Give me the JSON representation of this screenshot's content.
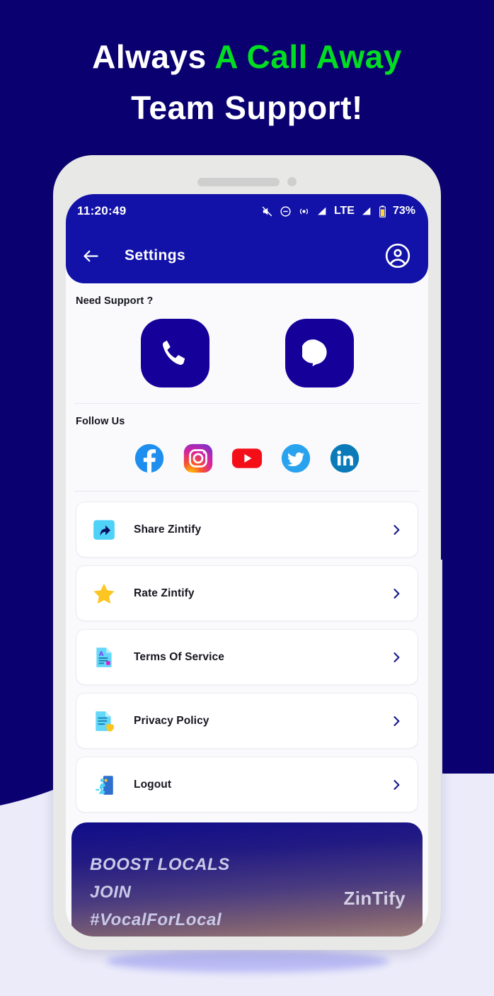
{
  "promo": {
    "headline_line1_white": "Always ",
    "headline_line1_green": "A Call Away",
    "headline_line2": "Team Support!",
    "green_accent": "#00dd22",
    "background_navy": "#0b0070",
    "background_lavender": "#ebebfa"
  },
  "phone": {
    "frame_color": "#e8e8e6",
    "screen_bg": "#fafafd"
  },
  "status_bar": {
    "time": "11:20:49",
    "icons": [
      "mute-icon",
      "do-not-disturb-icon",
      "hotspot-icon",
      "signal-icon"
    ],
    "network": "LTE",
    "second_signal": "signal-icon",
    "battery_icon": "battery-icon",
    "battery": "73%",
    "bar_color": "#1212a8"
  },
  "app_bar": {
    "back_icon": "arrow-left-icon",
    "title": "Settings",
    "account_icon": "account-circle-icon"
  },
  "support": {
    "label": "Need Support ?",
    "buttons": [
      {
        "name": "call-support-button",
        "icon": "phone-icon"
      },
      {
        "name": "chat-support-button",
        "icon": "chat-bubble-icon"
      }
    ],
    "button_color": "#150099"
  },
  "follow": {
    "label": "Follow Us",
    "networks": [
      {
        "name": "facebook",
        "icon": "facebook-icon",
        "color": "#1f8fef"
      },
      {
        "name": "instagram",
        "icon": "instagram-icon",
        "color": "#d6249f"
      },
      {
        "name": "youtube",
        "icon": "youtube-icon",
        "color": "#f40f18"
      },
      {
        "name": "twitter",
        "icon": "twitter-icon",
        "color": "#2aa3ef"
      },
      {
        "name": "linkedin",
        "icon": "linkedin-icon",
        "color": "#0a7bb8"
      }
    ]
  },
  "menu": {
    "chevron_icon": "chevron-right-icon",
    "chevron_color": "#1a1a8c",
    "items": [
      {
        "label": "Share Zintify",
        "icon": "share-icon"
      },
      {
        "label": "Rate Zintify",
        "icon": "star-icon"
      },
      {
        "label": "Terms Of Service",
        "icon": "document-text-icon"
      },
      {
        "label": "Privacy Policy",
        "icon": "document-shield-icon"
      },
      {
        "label": "Logout",
        "icon": "exit-door-icon"
      }
    ]
  },
  "banner": {
    "line1": "BOOST LOCALS",
    "line2": "JOIN",
    "line3": "#VocalForLocal",
    "logo": "ZinTify"
  }
}
